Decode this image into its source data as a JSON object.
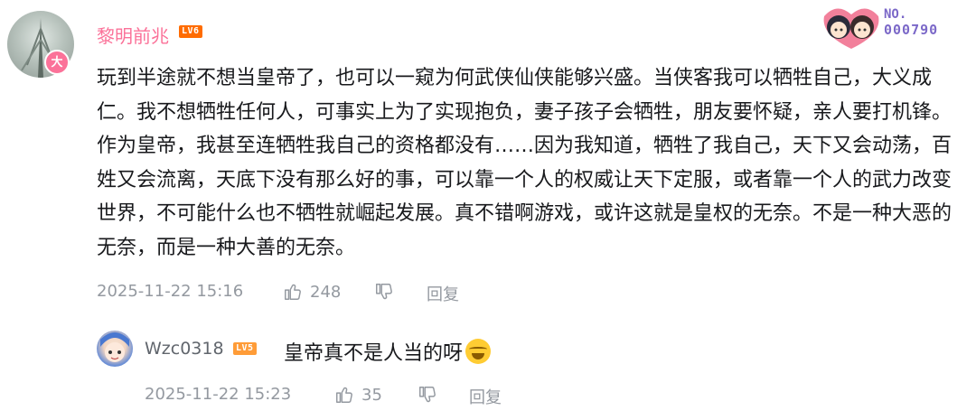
{
  "comment": {
    "username": "黎明前兆",
    "level_badge": "LV6",
    "avatar_badge": "大",
    "text": "玩到半途就不想当皇帝了，也可以一窥为何武侠仙侠能够兴盛。当侠客我可以牺牲自己，大义成仁。我不想牺牲任何人，可事实上为了实现抱负，妻子孩子会牺牲，朋友要怀疑，亲人要打机锋。作为皇帝，我甚至连牺牲我自己的资格都没有……因为我知道，牺牲了我自己，天下又会动荡，百姓又会流离，天底下没有那么好的事，可以靠一个人的权威让天下定服，或者靠一个人的武力改变世界，不可能什么也不牺牲就崛起发展。真不错啊游戏，或许这就是皇权的无奈。不是一种大恶的无奈，而是一种大善的无奈。",
    "timestamp": "2025-11-22 15:16",
    "likes": "248",
    "reply_label": "回复"
  },
  "decoration": {
    "no_label": "NO.",
    "no_number": "000790"
  },
  "reply": {
    "username": "Wzc0318",
    "level_badge": "LV5",
    "text": "皇帝真不是人当的呀",
    "emoji": "laughing-crying-emoji",
    "timestamp": "2025-11-22 15:23",
    "likes": "35",
    "reply_label": "回复"
  },
  "colors": {
    "username_pink": "#fb7299",
    "meta_gray": "#9499a0",
    "lv6": "#ff6c00",
    "lv5": "#ff9c38"
  }
}
